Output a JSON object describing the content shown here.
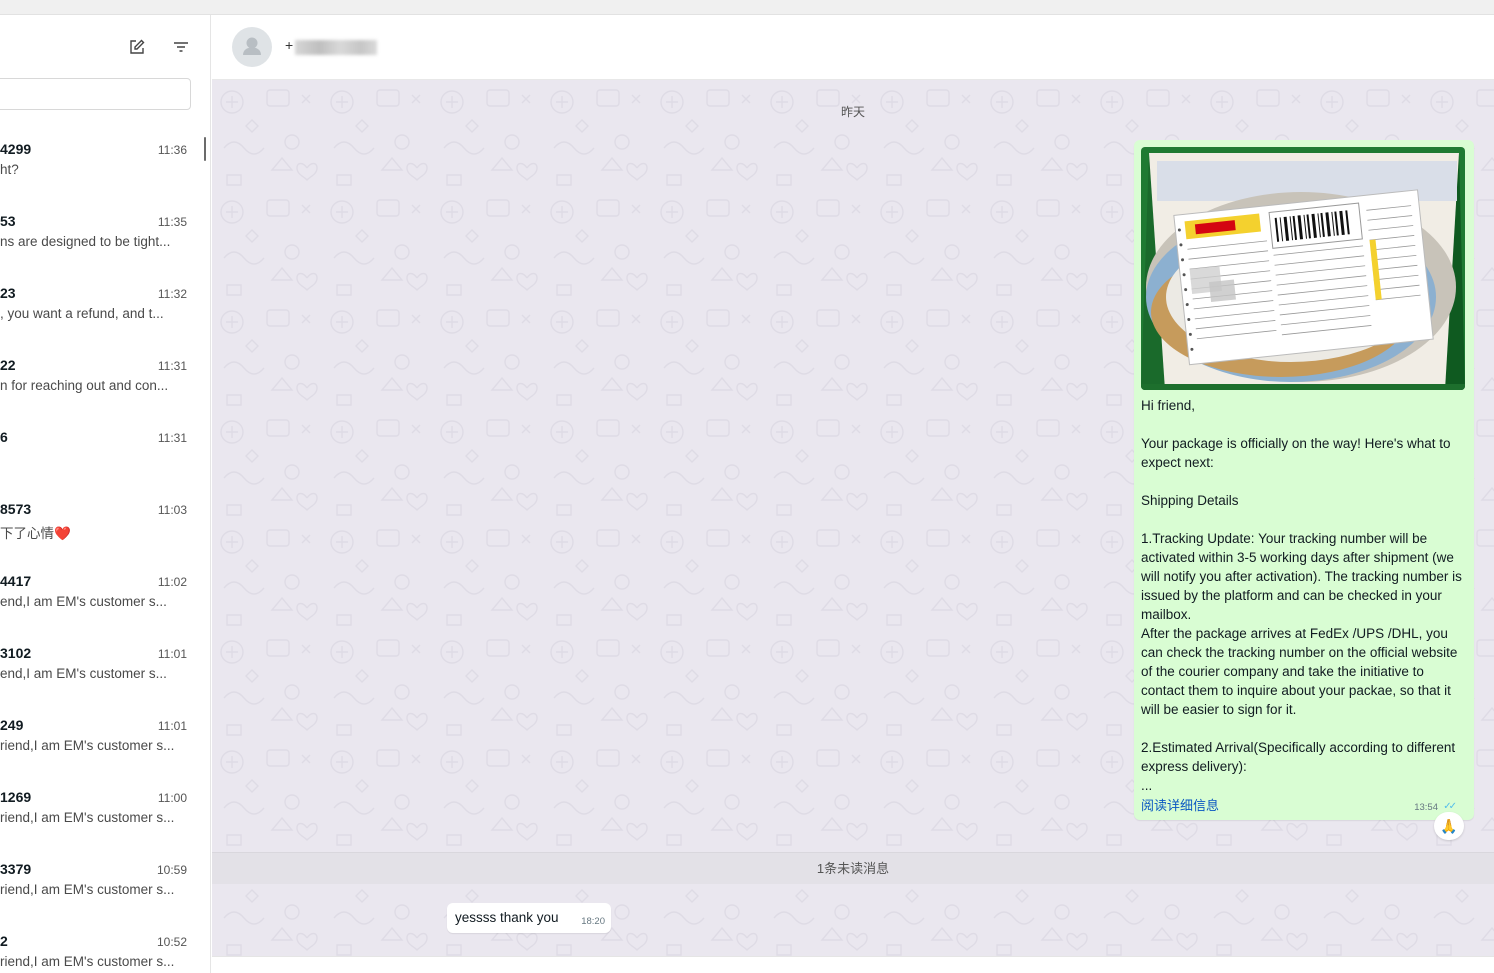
{
  "sidebar": {
    "search_placeholder": "",
    "chats": [
      {
        "name": "4299",
        "time": "11:36",
        "preview": "ht?"
      },
      {
        "name": "53",
        "time": "11:35",
        "preview": "ns are designed to be tight..."
      },
      {
        "name": "23",
        "time": "11:32",
        "preview": ", you want a refund, and t..."
      },
      {
        "name": "22",
        "time": "11:31",
        "preview": "n for reaching out and con..."
      },
      {
        "name": "6",
        "time": "11:31",
        "preview": ""
      },
      {
        "name": "8573",
        "time": "11:03",
        "preview": "下了心情❤️"
      },
      {
        "name": "4417",
        "time": "11:02",
        "preview": "end,I am EM's customer s..."
      },
      {
        "name": "3102",
        "time": "11:01",
        "preview": "end,I am EM's customer s..."
      },
      {
        "name": "249",
        "time": "11:01",
        "preview": "riend,I am EM's customer s..."
      },
      {
        "name": "1269",
        "time": "11:00",
        "preview": "riend,I am EM's customer s..."
      },
      {
        "name": "3379",
        "time": "10:59",
        "preview": "riend,I am EM's customer s..."
      },
      {
        "name": "2",
        "time": "10:52",
        "preview": "riend,I am EM's customer s..."
      }
    ]
  },
  "header": {
    "contact_prefix": "+"
  },
  "chat": {
    "date_separator": "昨天",
    "outgoing": {
      "lines": [
        "Hi friend,",
        "",
        "Your package is officially on the way!  Here's what to expect next:",
        "",
        "Shipping Details",
        "",
        "1.Tracking Update: Your tracking number will be activated within 3-5 working days after shipment (we will notify you after activation). The tracking number is issued by the platform and can be checked in your mailbox.",
        "After the package arrives at FedEx /UPS /DHL, you can check the tracking number on the official website of the courier company and take the initiative to contact them to inquire about your packae, so that it will be easier to sign for it.",
        "",
        "2.Estimated Arrival(Specifically according to different express delivery):",
        "..."
      ],
      "read_more": "阅读详细信息",
      "time": "13:54",
      "reaction": "🙏"
    },
    "unread_label": "1条未读消息",
    "incoming": {
      "text": "yessss thank you",
      "time": "18:20"
    }
  },
  "colors": {
    "outgoing_bubble": "#d9fdd3",
    "chat_bg": "#eae7ef",
    "link": "#0a57c2",
    "read_ticks": "#53bdeb"
  }
}
